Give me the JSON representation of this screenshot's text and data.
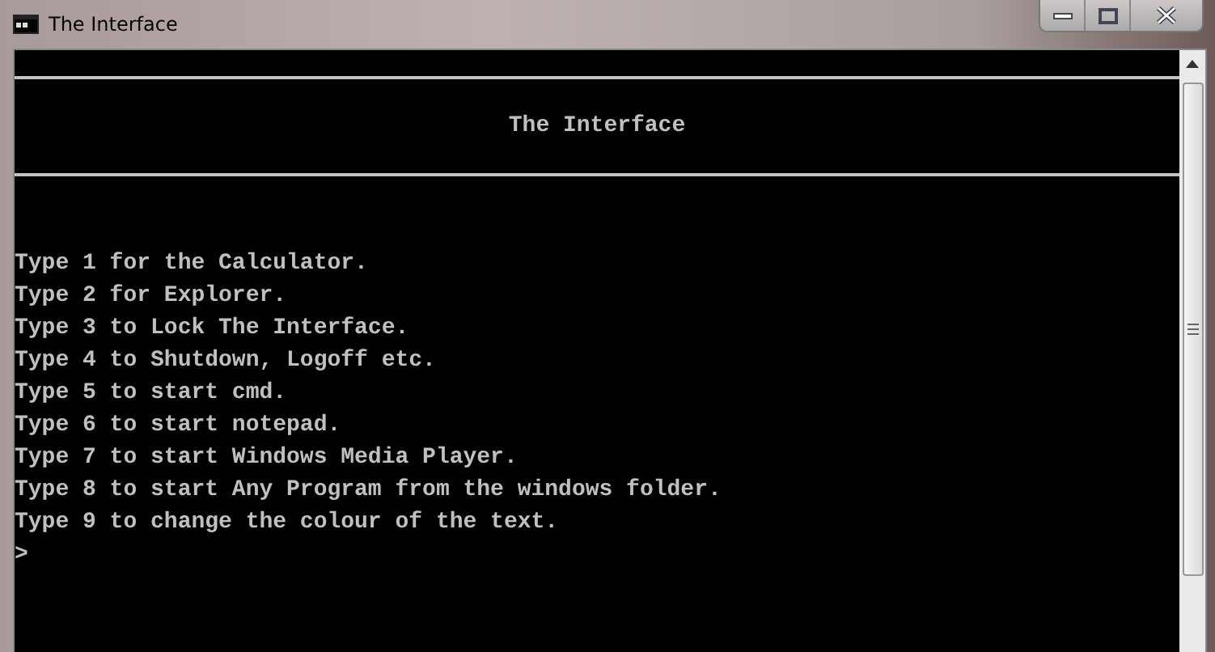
{
  "window": {
    "title": "The Interface"
  },
  "console": {
    "heading": "The Interface",
    "lines": [
      "Type 1 for the Calculator.",
      "Type 2 for Explorer.",
      "Type 3 to Lock The Interface.",
      "Type 4 to Shutdown, Logoff etc.",
      "Type 5 to start cmd.",
      "Type 6 to start notepad.",
      "Type 7 to start Windows Media Player.",
      "Type 8 to start Any Program from the windows folder.",
      "Type 9 to change the colour of the text."
    ],
    "prompt": ">"
  }
}
